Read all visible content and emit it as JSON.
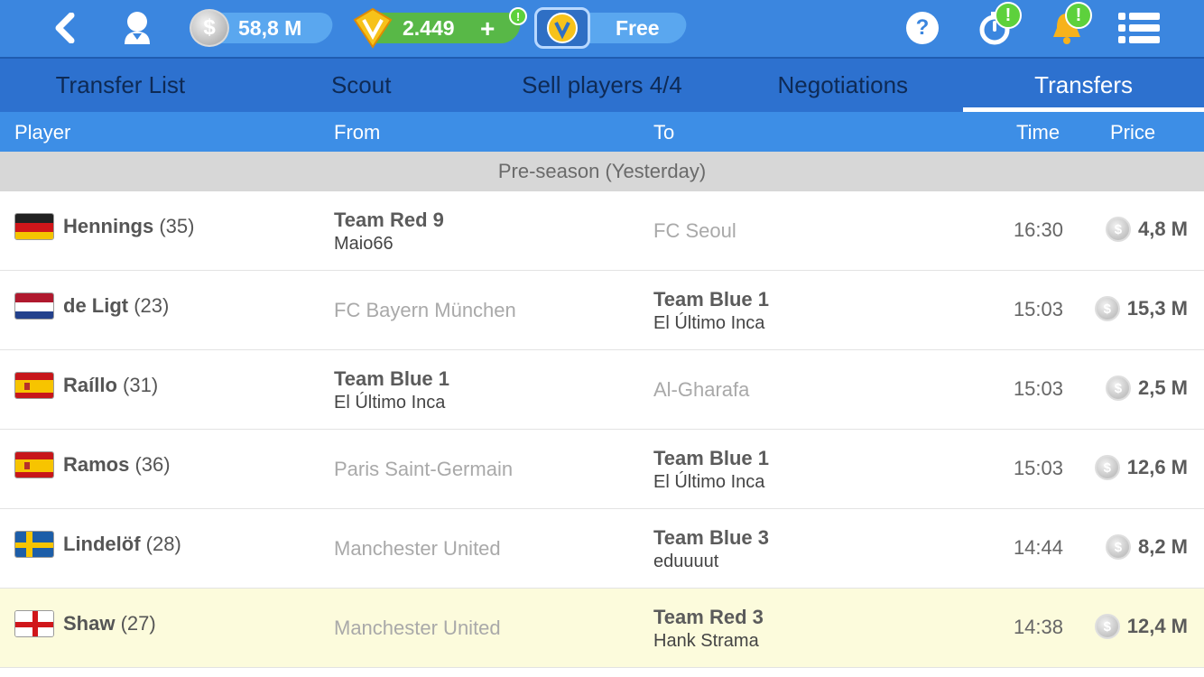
{
  "topbar": {
    "coins": "58,8 M",
    "coin_symbol": "$",
    "gems": "2.449",
    "gems_add": "+",
    "gems_alert": "!",
    "free_label": "Free",
    "help_symbol": "?",
    "timer_alert": "!",
    "bell_alert": "!"
  },
  "tabs": [
    {
      "label": "Transfer List",
      "active": false
    },
    {
      "label": "Scout",
      "active": false
    },
    {
      "label": "Sell players 4/4",
      "active": false
    },
    {
      "label": "Negotiations",
      "active": false
    },
    {
      "label": "Transfers",
      "active": true
    }
  ],
  "columns": {
    "player": "Player",
    "from": "From",
    "to": "To",
    "time": "Time",
    "price": "Price"
  },
  "section_title": "Pre-season (Yesterday)",
  "rows": [
    {
      "flag": "germany",
      "name": "Hennings",
      "age": "(35)",
      "from_team": "Team Red 9",
      "from_manager": "Maio66",
      "from_club": "",
      "to_team": "",
      "to_manager": "",
      "to_club": "FC Seoul",
      "time": "16:30",
      "price": "4,8 M",
      "highlight": false
    },
    {
      "flag": "netherlands",
      "name": "de Ligt",
      "age": "(23)",
      "from_team": "",
      "from_manager": "",
      "from_club": "FC Bayern München",
      "to_team": "Team Blue 1",
      "to_manager": "El Último Inca",
      "to_club": "",
      "time": "15:03",
      "price": "15,3 M",
      "highlight": false
    },
    {
      "flag": "spain",
      "name": "Raíllo",
      "age": "(31)",
      "from_team": "Team Blue 1",
      "from_manager": "El Último Inca",
      "from_club": "",
      "to_team": "",
      "to_manager": "",
      "to_club": "Al-Gharafa",
      "time": "15:03",
      "price": "2,5 M",
      "highlight": false
    },
    {
      "flag": "spain",
      "name": "Ramos",
      "age": "(36)",
      "from_team": "",
      "from_manager": "",
      "from_club": "Paris Saint-Germain",
      "to_team": "Team Blue 1",
      "to_manager": "El Último Inca",
      "to_club": "",
      "time": "15:03",
      "price": "12,6 M",
      "highlight": false
    },
    {
      "flag": "sweden",
      "name": "Lindelöf",
      "age": "(28)",
      "from_team": "",
      "from_manager": "",
      "from_club": "Manchester United",
      "to_team": "Team Blue 3",
      "to_manager": "eduuuut",
      "to_club": "",
      "time": "14:44",
      "price": "8,2 M",
      "highlight": false
    },
    {
      "flag": "england",
      "name": "Shaw",
      "age": "(27)",
      "from_team": "",
      "from_manager": "",
      "from_club": "Manchester United",
      "to_team": "Team Red 3",
      "to_manager": "Hank Strama",
      "to_club": "",
      "time": "14:38",
      "price": "12,4 M",
      "highlight": true
    }
  ],
  "colors": {
    "topbar": "#3b86df",
    "tabs": "#2d71cf",
    "header": "#3d8ee6",
    "highlight_row": "#fcfbdc"
  }
}
